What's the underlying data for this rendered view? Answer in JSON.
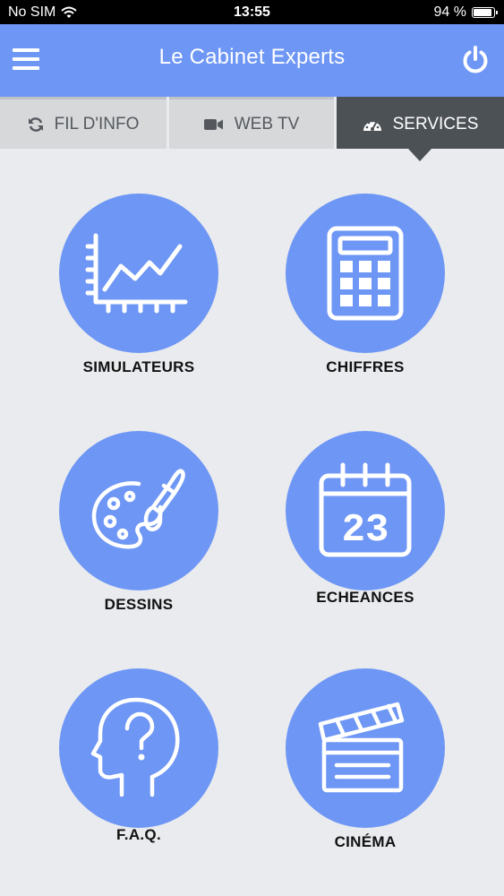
{
  "status_bar": {
    "carrier": "No SIM",
    "time": "13:55",
    "battery": "94 %",
    "battery_level": 0.94
  },
  "header": {
    "title": "Le Cabinet Experts",
    "menu_icon": "hamburger-menu-icon",
    "power_icon": "power-icon"
  },
  "tabs": [
    {
      "label": "FIL D'INFO",
      "icon": "refresh-icon",
      "active": false
    },
    {
      "label": "WEB TV",
      "icon": "video-camera-icon",
      "active": false
    },
    {
      "label": "SERVICES",
      "icon": "dashboard-gauge-icon",
      "active": true
    }
  ],
  "services": [
    {
      "label": "SIMULATEURS",
      "icon": "line-chart-icon"
    },
    {
      "label": "CHIFFRES",
      "icon": "calculator-icon"
    },
    {
      "label": "DESSINS",
      "icon": "palette-brush-icon"
    },
    {
      "label": "ECHEANCES",
      "icon": "calendar-icon",
      "calendar_day": "23"
    },
    {
      "label": "F.A.Q.",
      "icon": "head-question-icon"
    },
    {
      "label": "CINÉMA",
      "icon": "clapperboard-icon"
    }
  ],
  "colors": {
    "accent": "#6e96f5",
    "tab_active": "#4c5156",
    "tab_inactive": "#d6d8da",
    "background": "#e9ebee"
  }
}
